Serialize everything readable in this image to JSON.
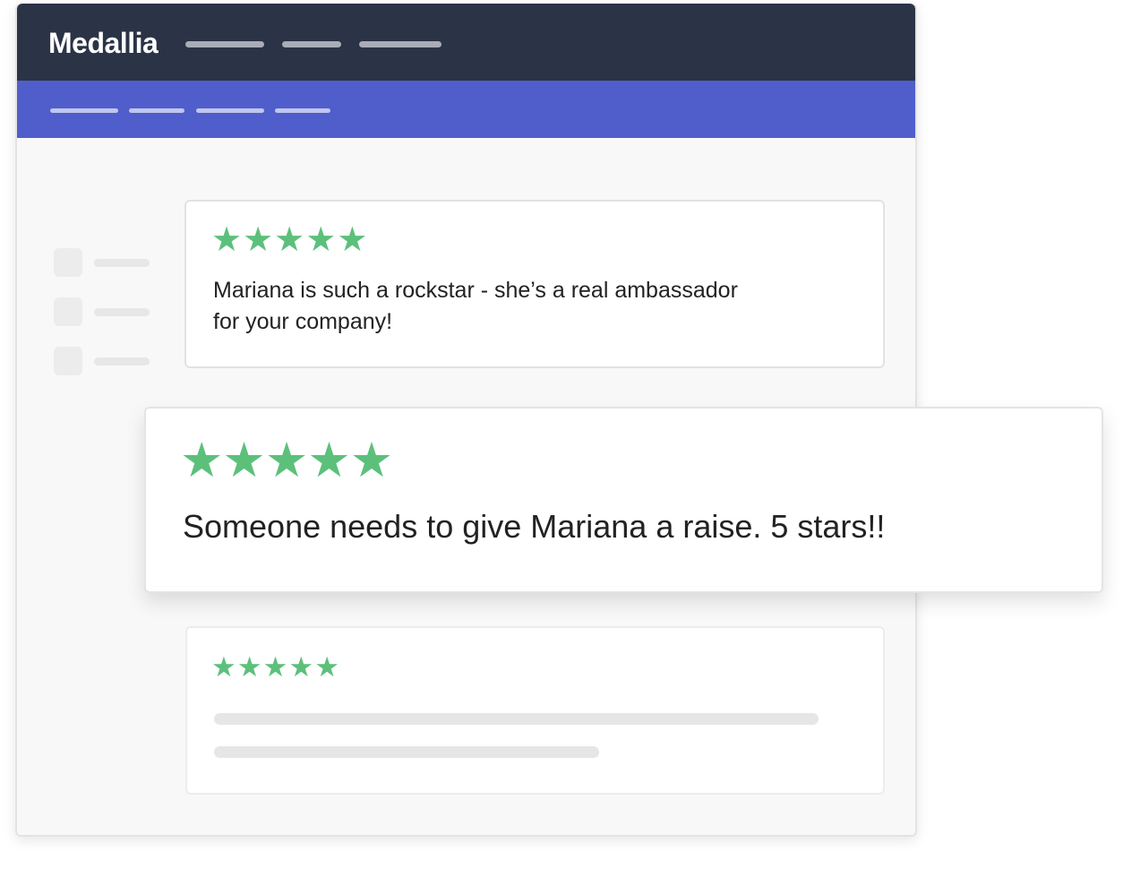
{
  "app": {
    "brand": "Medallia"
  },
  "colors": {
    "topbar": "#2b3346",
    "subbar": "#4f5ecb",
    "star": "#5cc07b"
  },
  "reviews": [
    {
      "rating": 5,
      "star_glyph": "★",
      "text_line1": "Mariana is such a rockstar - she’s a real ambassador",
      "text_line2": "for your company!"
    },
    {
      "rating": 5,
      "star_glyph": "★",
      "text": "Someone needs to give Mariana a raise. 5 stars!!"
    },
    {
      "rating": 5,
      "star_glyph": "★"
    }
  ]
}
